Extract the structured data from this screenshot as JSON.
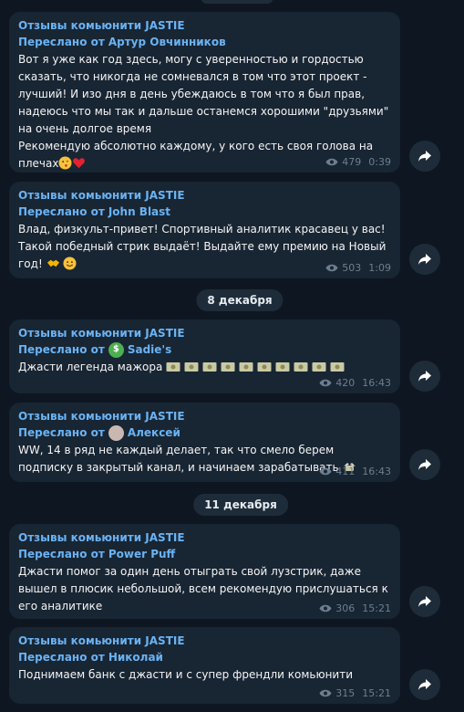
{
  "channel_name": "Отзывы комьюнити JASTIE",
  "messages": [
    {
      "forwarded_label": "Переслано от",
      "author": "Артур Овчинников",
      "text": "Вот я уже как год здесь, могу с уверенностью и гордостью сказать, что никогда не сомневался в том что этот проект - лучший! И изо дня в день убеждаюсь в том что я был прав, надеюсь что мы так и дальше останемся хорошими \"друзьями\" на очень долгое время\nРекомендую абсолютно каждому, у кого есть своя голова на плечах",
      "views": "479",
      "time": "0:39"
    },
    {
      "forwarded_label": "Переслано от",
      "author": "John Blast",
      "text": "Влад, физкульт-привет! Спортивный аналитик красавец у вас! Такой победный стрик выдаёт! Выдайте ему премию на Новый год!",
      "views": "503",
      "time": "1:09"
    },
    {
      "forwarded_label": "Переслано от",
      "author": "Sadie's",
      "text": "Джасти легенда мажора",
      "views": "420",
      "time": "16:43"
    },
    {
      "forwarded_label": "Переслано от",
      "author": "Алексей",
      "text": "WW, 14 в ряд не каждый делает, так что смело берем подписку в закрытый канал, и начинаем зарабатывать",
      "views": "411",
      "time": "16:43"
    },
    {
      "forwarded_label": "Переслано от",
      "author": "Power Puff",
      "text": "Джасти помог за один день отыграть свой лузстрик, даже вышел в плюсик небольшой, всем рекомендую прислушаться к его аналитике",
      "views": "306",
      "time": "15:21"
    },
    {
      "forwarded_label": "Переслано от",
      "author": "Николай",
      "text": "Поднимаем банк с джасти и с супер френдли комьюнити",
      "views": "315",
      "time": "15:21"
    }
  ],
  "date_separators": [
    "8 декабря",
    "11 декабря"
  ],
  "colors": {
    "background": "#0e1621",
    "bubble": "#182533",
    "accent": "#6ab3f3",
    "text": "#f5f5f5",
    "meta": "#6d7f8f"
  },
  "icons": [
    "eye-icon",
    "share-arrow-icon",
    "money-bag-emoji",
    "money-bill-emoji",
    "heart-emoji",
    "handshake-emoji",
    "smile-emoji"
  ]
}
